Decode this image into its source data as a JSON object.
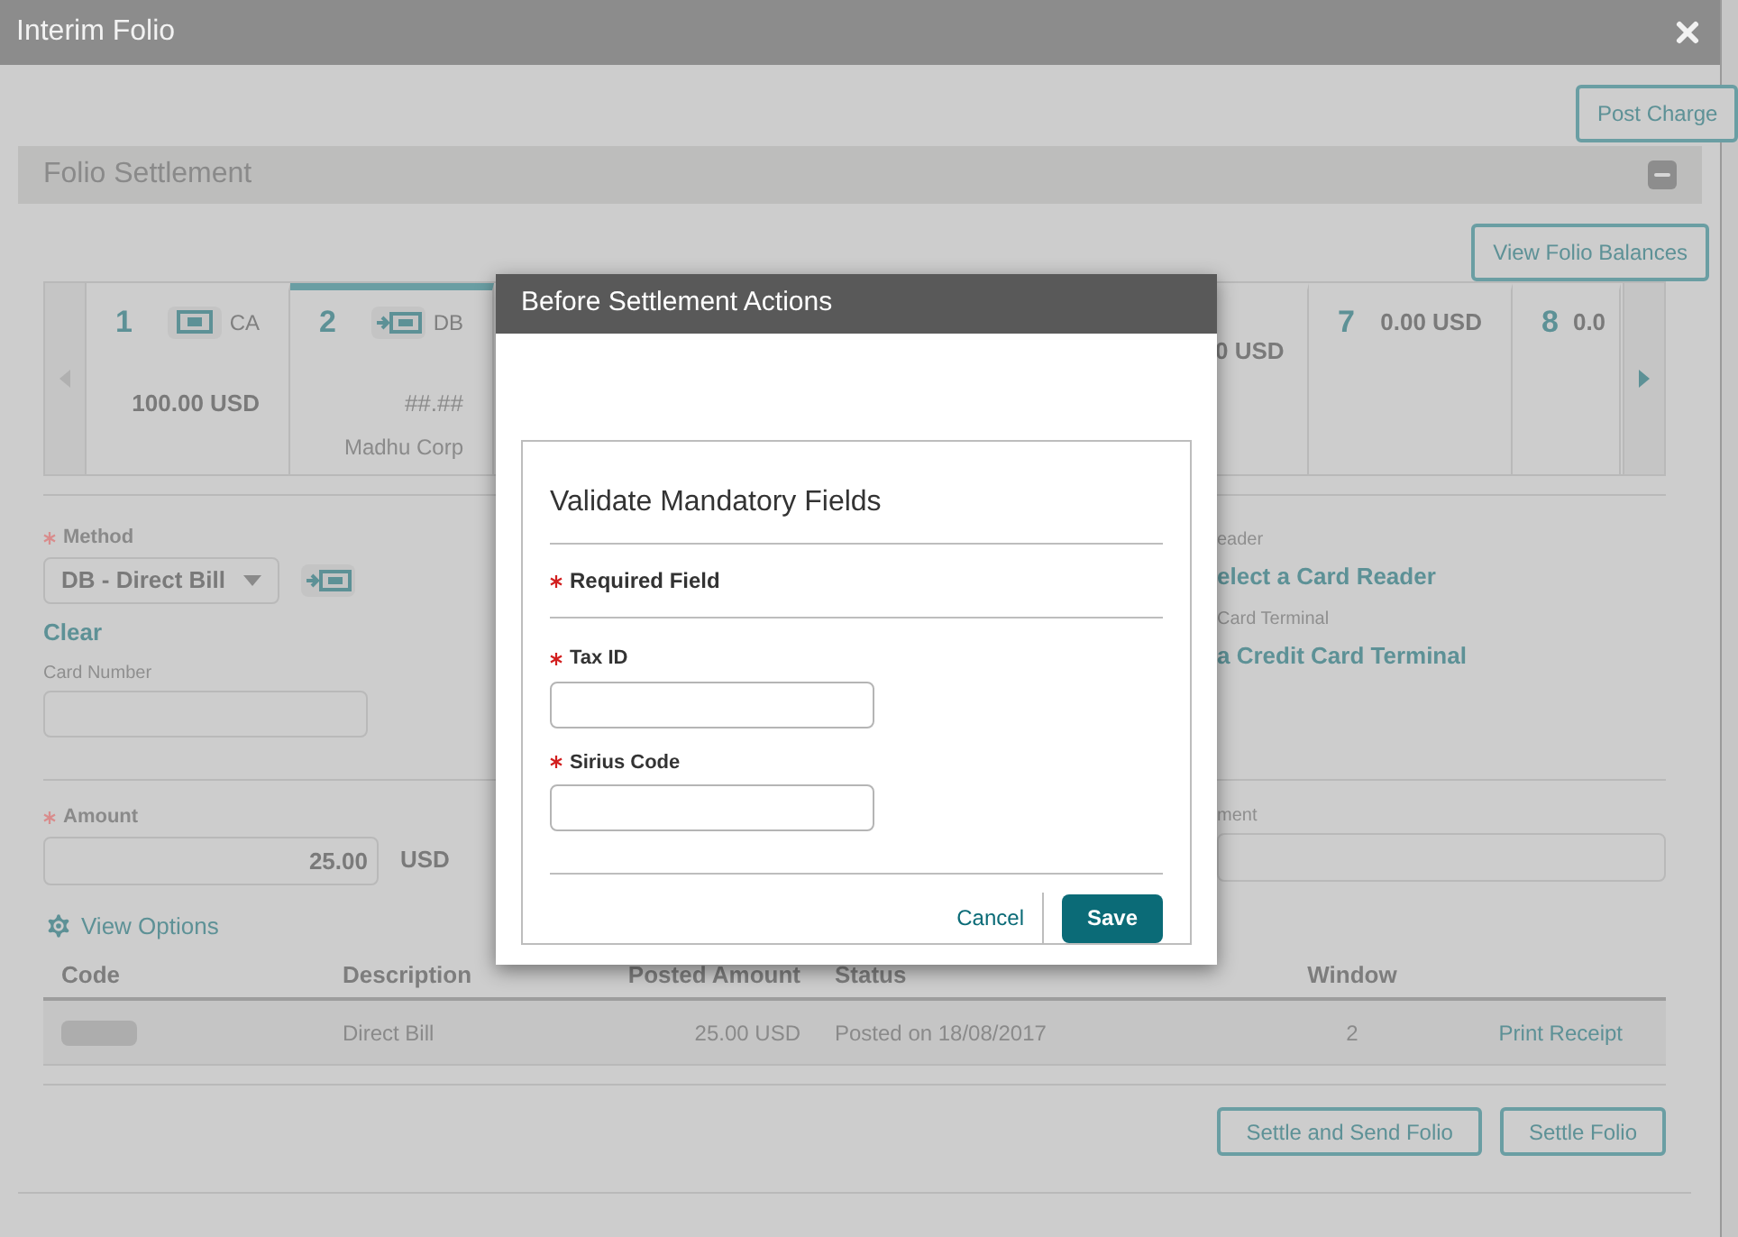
{
  "window": {
    "title": "Interim Folio"
  },
  "post_charge": "Post Charge",
  "section": {
    "title": "Folio Settlement",
    "expanded": true
  },
  "view_balances": "View Folio Balances",
  "folio_windows": [
    {
      "kind": "cash",
      "number": "1",
      "type": "CA",
      "amount": "100.00 USD",
      "selected": false
    },
    {
      "kind": "transfer",
      "number": "2",
      "type": "DB",
      "amount": "##.##",
      "payee": "Madhu Corp",
      "selected": true
    },
    {
      "kind": "partial",
      "amount": "0 USD",
      "selected": false
    },
    {
      "kind": "full",
      "number": "7",
      "amount": "0.00 USD",
      "selected": false
    },
    {
      "kind": "cut",
      "number": "8",
      "amount": "0.0",
      "selected": false
    }
  ],
  "method": {
    "label": "Method",
    "required": true,
    "value": "DB - Direct Bill",
    "clear": "Clear"
  },
  "card_number": {
    "label": "Card Number"
  },
  "card_reader": {
    "label": "eader",
    "link": "elect a Card Reader"
  },
  "terminal": {
    "label": "Card Terminal",
    "link": "a Credit Card Terminal"
  },
  "amount": {
    "label": "Amount",
    "required": true,
    "value": "25.00",
    "currency": "USD"
  },
  "comment": {
    "label": "ment"
  },
  "view_options": "View Options",
  "table": {
    "columns": [
      "Code",
      "Description",
      "Posted Amount",
      "Status",
      "Window"
    ],
    "rows": [
      {
        "description": "Direct Bill",
        "posted_amount": "25.00 USD",
        "status": "Posted on 18/08/2017",
        "window": "2",
        "action": "Print Receipt"
      }
    ]
  },
  "footer_buttons": [
    "Settle and Send Folio",
    "Settle Folio"
  ],
  "dialog": {
    "title": "Before Settlement Actions",
    "heading": "Validate Mandatory Fields",
    "legend": "Required Field",
    "fields": [
      {
        "label": "Tax ID",
        "required": true
      },
      {
        "label": "Sirius Code",
        "required": true
      }
    ],
    "buttons": [
      {
        "label": "Cancel",
        "kind": "link"
      },
      {
        "label": "Save",
        "kind": "primary"
      }
    ]
  }
}
